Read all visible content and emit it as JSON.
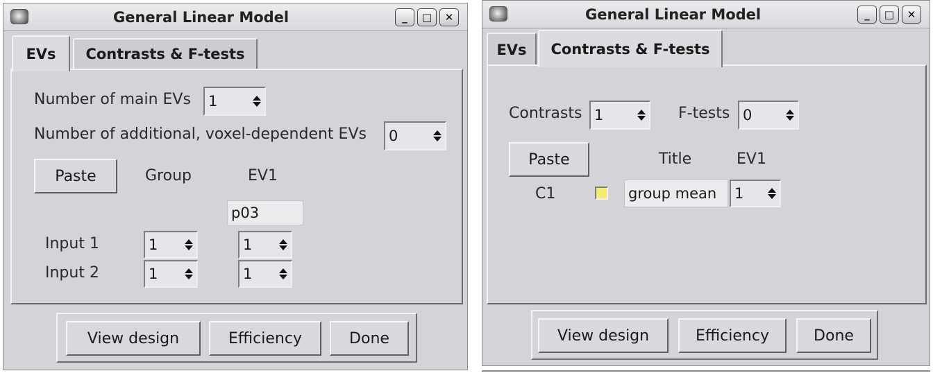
{
  "left_window": {
    "title": "General Linear Model",
    "controls": [
      "minimize",
      "maximize",
      "close"
    ],
    "tabs": [
      {
        "label": "EVs",
        "selected": true
      },
      {
        "label": "Contrasts & F-tests",
        "selected": false
      }
    ],
    "main_evs_label": "Number of main EVs",
    "main_evs_value": "1",
    "additional_evs_label": "Number of additional, voxel-dependent EVs",
    "additional_evs_value": "0",
    "paste_label": "Paste",
    "group_header": "Group",
    "ev1_header": "EV1",
    "ev1_name": "p03",
    "rows": [
      {
        "label": "Input 1",
        "group": "1",
        "ev1": "1"
      },
      {
        "label": "Input 2",
        "group": "1",
        "ev1": "1"
      }
    ],
    "buttons": {
      "view_design": "View design",
      "efficiency": "Efficiency",
      "done": "Done"
    }
  },
  "right_window": {
    "title": "General Linear Model",
    "controls": [
      "minimize",
      "maximize",
      "close"
    ],
    "tabs": [
      {
        "label": "EVs",
        "selected": false
      },
      {
        "label": "Contrasts & F-tests",
        "selected": true
      }
    ],
    "contrasts_label": "Contrasts",
    "contrasts_value": "1",
    "ftests_label": "F-tests",
    "ftests_value": "0",
    "paste_label": "Paste",
    "title_header": "Title",
    "ev1_header": "EV1",
    "contrast_rows": [
      {
        "label": "C1",
        "checked": true,
        "title": "group mean",
        "ev1": "1"
      }
    ],
    "buttons": {
      "view_design": "View design",
      "efficiency": "Efficiency",
      "done": "Done"
    }
  },
  "colors": {
    "window_bg": "#d4d4d8",
    "checkbox_fill": "#f4ec6a"
  },
  "icons": {
    "app": "brain-icon",
    "minimize": "minimize-icon",
    "maximize": "maximize-icon",
    "close": "close-icon"
  }
}
